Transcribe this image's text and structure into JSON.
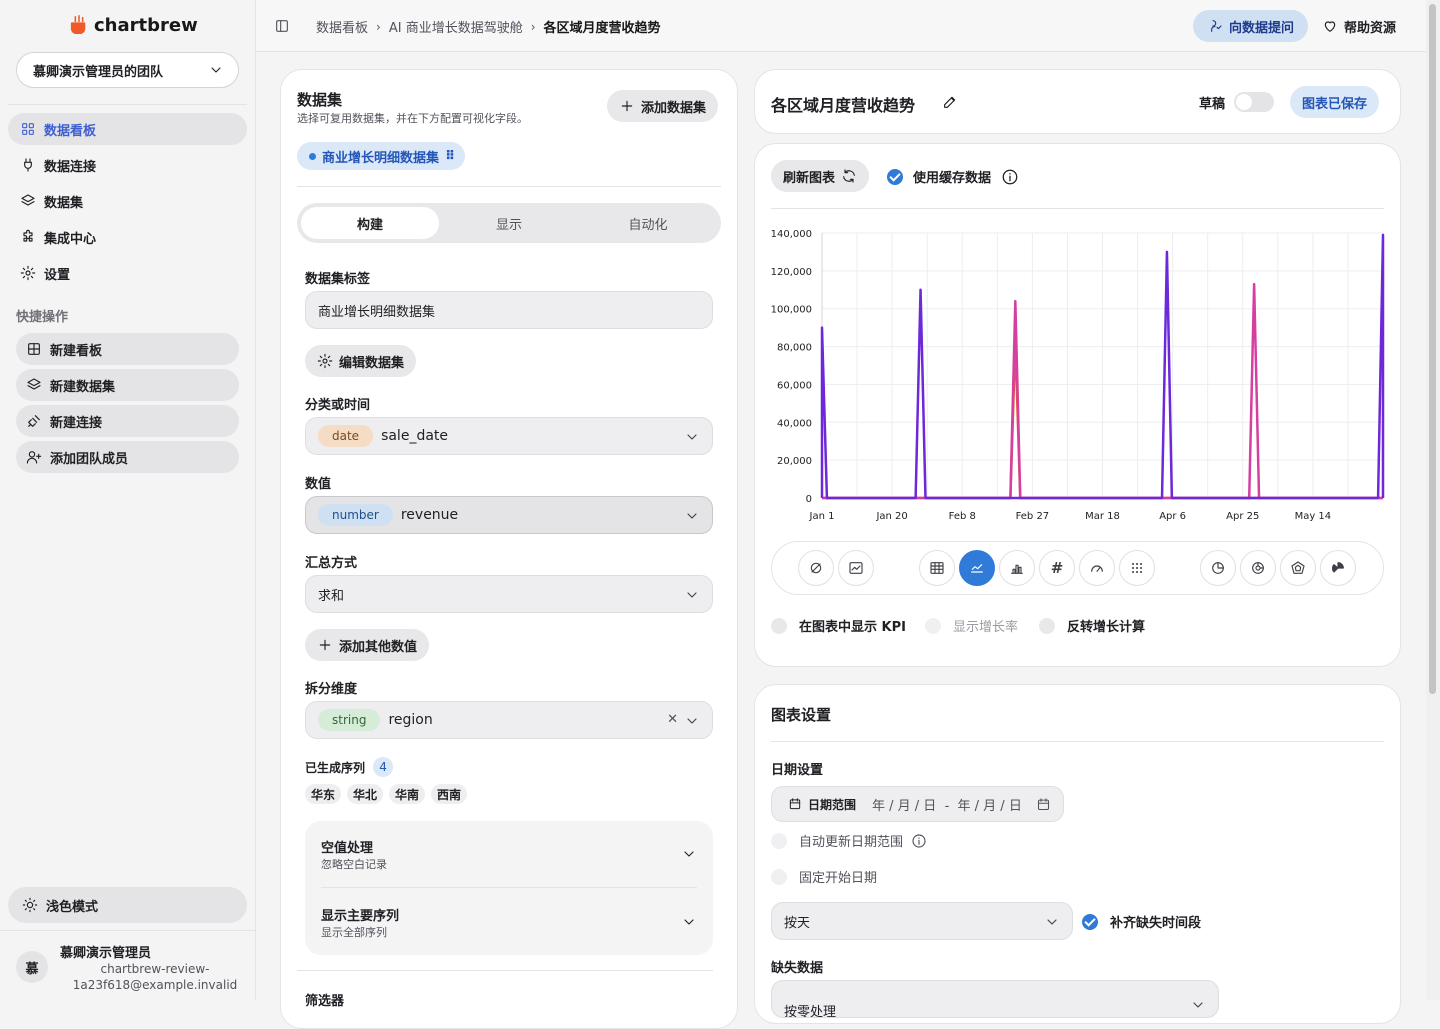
{
  "app": {
    "brand": "chartbrew",
    "team": "慕卿演示管理员的团队"
  },
  "nav": [
    {
      "label": "数据看板"
    },
    {
      "label": "数据连接"
    },
    {
      "label": "数据集"
    },
    {
      "label": "集成中心"
    },
    {
      "label": "设置"
    }
  ],
  "quick_actions": {
    "title": "快捷操作",
    "items": [
      {
        "label": "新建看板"
      },
      {
        "label": "新建数据集"
      },
      {
        "label": "新建连接"
      },
      {
        "label": "添加团队成员"
      }
    ]
  },
  "light_mode": "浅色模式",
  "user": {
    "name": "慕卿演示管理员",
    "email": "chartbrew-review-1a23f618@example.invalid",
    "initial": "慕"
  },
  "breadcrumb": {
    "items": [
      "数据看板",
      "AI 商业增长数据驾驶舱",
      "各区域月度营收趋势"
    ]
  },
  "topbar": {
    "ask": "向数据提问",
    "help": "帮助资源"
  },
  "dataset_panel": {
    "title": "数据集",
    "subtitle": "选择可复用数据集，并在下方配置可视化字段。",
    "add_button": "添加数据集",
    "active_dataset": "商业增长明细数据集",
    "tabs": [
      "构建",
      "显示",
      "自动化"
    ],
    "active_tab": 0,
    "label_title": "数据集标签",
    "label_value": "商业增长明细数据集",
    "edit_button": "编辑数据集",
    "dimension": {
      "title": "分类或时间",
      "type": "date",
      "field": "sale_date"
    },
    "metric": {
      "title": "数值",
      "type": "number",
      "field": "revenue"
    },
    "aggregation": {
      "title": "汇总方式",
      "value": "求和"
    },
    "add_metric": "添加其他数值",
    "breakdown": {
      "title": "拆分维度",
      "type": "string",
      "field": "region"
    },
    "series": {
      "title": "已生成序列",
      "count": "4",
      "items": [
        "华东",
        "华北",
        "华南",
        "西南"
      ]
    },
    "null_handling": {
      "title": "空值处理",
      "subtitle": "忽略空白记录"
    },
    "main_series": {
      "title": "显示主要序列",
      "subtitle": "显示全部序列"
    },
    "filters_title": "筛选器"
  },
  "chart_header": {
    "title": "各区域月度营收趋势",
    "draft": "草稿",
    "saved": "图表已保存"
  },
  "chart_panel": {
    "refresh": "刷新图表",
    "use_cache": "使用缓存数据",
    "kpi": "在图表中显示 KPI",
    "growth": "显示增长率",
    "invert": "反转增长计算"
  },
  "chart_data": {
    "type": "line",
    "ylim": [
      0,
      140000
    ],
    "yticks": [
      "0",
      "20,000",
      "40,000",
      "60,000",
      "80,000",
      "100,000",
      "120,000",
      "140,000"
    ],
    "xticks": [
      "Jan 1",
      "Jan 20",
      "Feb 8",
      "Feb 27",
      "Mar 18",
      "Apr 6",
      "Apr 25",
      "May 14"
    ],
    "x_start": "2024-01-01",
    "x_end": "2024-05-28",
    "series": [
      {
        "color": "#e05a2b",
        "points": [
          [
            "2024-02-21",
            84000
          ]
        ]
      },
      {
        "color": "#d63fa0",
        "points": [
          [
            "2024-02-21",
            104000
          ],
          [
            "2024-04-24",
            113000
          ]
        ]
      },
      {
        "color": "#6d28d9",
        "points": [
          [
            "2024-01-01",
            90000
          ],
          [
            "2024-01-27",
            110000
          ],
          [
            "2024-04-01",
            130000
          ],
          [
            "2024-05-28",
            139000
          ]
        ]
      }
    ]
  },
  "chart_settings": {
    "title": "图表设置",
    "date_title": "日期设置",
    "date_range": "日期范围",
    "date_placeholder": "年 / 月 / 日  -  年 / 月 / 日",
    "auto_update": "自动更新日期范围",
    "fixed_start": "固定开始日期",
    "interval": "按天",
    "fill_missing": "补齐缺失时间段",
    "missing_title": "缺失数据",
    "missing_value": "按零处理"
  }
}
